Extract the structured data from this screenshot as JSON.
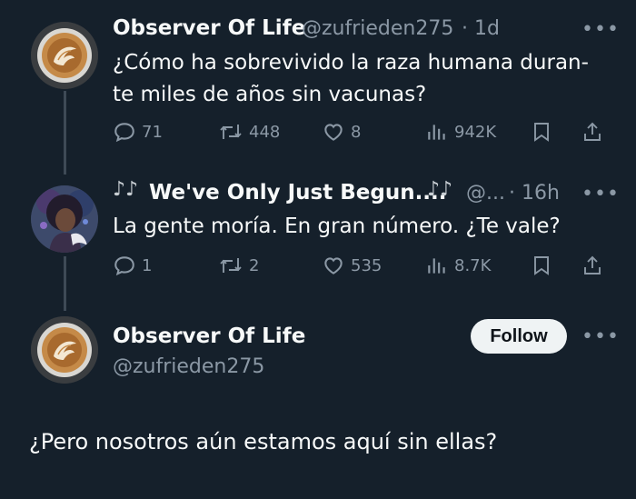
{
  "colors": {
    "background": "#15202b",
    "text": "#f7f9f9",
    "muted": "#8b98a5",
    "thread_line": "#3e4a56",
    "follow_bg": "#eff3f4"
  },
  "tweet1": {
    "display_name": "Observer Of Life",
    "handle": "@zufrieden275",
    "time": "· 1d",
    "text_line1": "¿Cómo ha sobrevivido la raza humana duran-",
    "text_line2": "te miles de años sin vacunas?",
    "replies": "71",
    "reposts": "448",
    "likes": "8",
    "views": "942K",
    "more": "•••"
  },
  "tweet2": {
    "display_name": "We've Only Just Begun....",
    "handle": "@...",
    "time": "· 16h",
    "text": "La gente moría. En gran número. ¿Te vale?",
    "replies": "1",
    "reposts": "2",
    "likes": "535",
    "views": "8.7K",
    "more": "•••"
  },
  "main_tweet": {
    "display_name": "Observer Of Life",
    "handle": "@zufrieden275",
    "follow_label": "Follow",
    "text": "¿Pero nosotros aún estamos aquí sin ellas?",
    "more": "•••"
  }
}
